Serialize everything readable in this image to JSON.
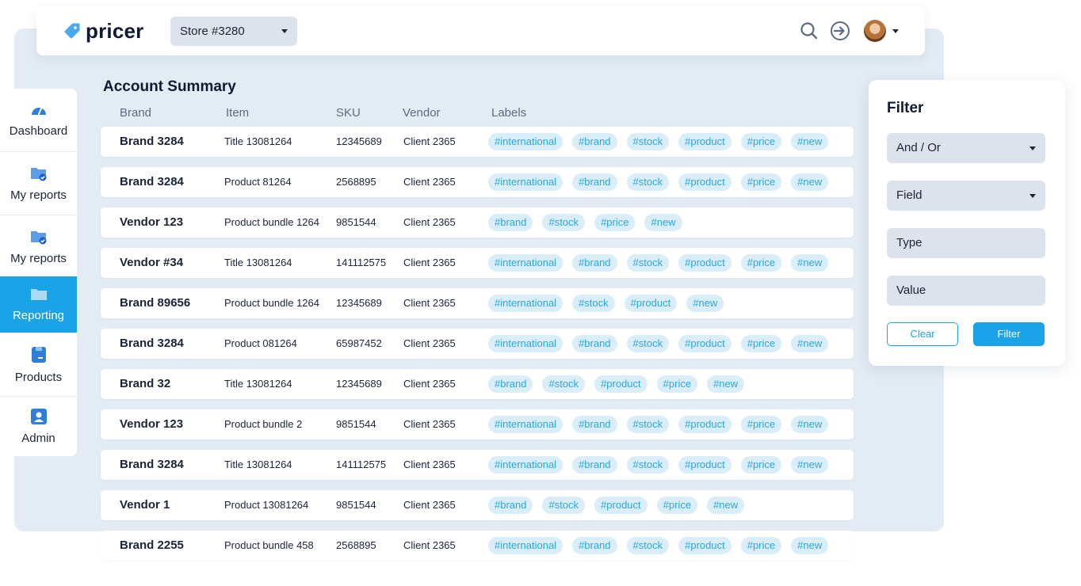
{
  "brand": {
    "logo_text": "pricer",
    "accent": "#1aa3e6",
    "tag_bg": "#d9eef9",
    "tag_text": "#2aa7e0"
  },
  "header": {
    "store_select": "Store #3280",
    "icons": [
      "search-icon",
      "sign-in-icon",
      "avatar",
      "chevron-down-icon"
    ]
  },
  "sidebar": {
    "items": [
      {
        "label": "Dashboard",
        "icon": "dashboard-gauge-icon"
      },
      {
        "label": "My reports",
        "icon": "folder-check-icon"
      },
      {
        "label": "My reports",
        "icon": "folder-check-icon"
      },
      {
        "label": "Reporting",
        "icon": "folder-icon",
        "active": true
      },
      {
        "label": "Products",
        "icon": "product-box-icon"
      },
      {
        "label": "Admin",
        "icon": "user-icon"
      }
    ]
  },
  "table": {
    "title": "Account Summary",
    "columns": [
      "Brand",
      "Item",
      "SKU",
      "Vendor",
      "Labels"
    ],
    "rows": [
      {
        "brand": "Brand 3284",
        "item": "Title 13081264",
        "sku": "12345689",
        "vendor": "Client 2365",
        "labels": [
          "#international",
          "#brand",
          "#stock",
          "#product",
          "#price",
          "#new"
        ]
      },
      {
        "brand": "Brand 3284",
        "item": "Product 81264",
        "sku": "2568895",
        "vendor": "Client 2365",
        "labels": [
          "#international",
          "#brand",
          "#stock",
          "#product",
          "#price",
          "#new"
        ]
      },
      {
        "brand": "Vendor 123",
        "item": "Product bundle 1264",
        "sku": "9851544",
        "vendor": "Client 2365",
        "labels": [
          "#brand",
          "#stock",
          "#price",
          "#new"
        ]
      },
      {
        "brand": "Vendor #34",
        "item": "Title 13081264",
        "sku": "141112575",
        "vendor": "Client 2365",
        "labels": [
          "#international",
          "#brand",
          "#stock",
          "#product",
          "#price",
          "#new"
        ]
      },
      {
        "brand": "Brand 89656",
        "item": "Product bundle 1264",
        "sku": "12345689",
        "vendor": "Client 2365",
        "labels": [
          "#international",
          "#stock",
          "#product",
          "#new"
        ]
      },
      {
        "brand": "Brand 3284",
        "item": "Product  081264",
        "sku": "65987452",
        "vendor": "Client 2365",
        "labels": [
          "#international",
          "#brand",
          "#stock",
          "#product",
          "#price",
          "#new"
        ]
      },
      {
        "brand": "Brand 32",
        "item": "Title 13081264",
        "sku": "12345689",
        "vendor": "Client 2365",
        "labels": [
          "#brand",
          "#stock",
          "#product",
          "#price",
          "#new"
        ]
      },
      {
        "brand": "Vendor 123",
        "item": "Product bundle 2",
        "sku": "9851544",
        "vendor": "Client 2365",
        "labels": [
          "#international",
          "#brand",
          "#stock",
          "#product",
          "#price",
          "#new"
        ]
      },
      {
        "brand": "Brand 3284",
        "item": "Title 13081264",
        "sku": "141112575",
        "vendor": "Client 2365",
        "labels": [
          "#international",
          "#brand",
          "#stock",
          "#product",
          "#price",
          "#new"
        ]
      },
      {
        "brand": "Vendor 1",
        "item": "Product  13081264",
        "sku": "9851544",
        "vendor": "Client 2365",
        "labels": [
          "#brand",
          "#stock",
          "#product",
          "#price",
          "#new"
        ]
      },
      {
        "brand": "Brand 2255",
        "item": "Product bundle 458",
        "sku": "2568895",
        "vendor": "Client 2365",
        "labels": [
          "#international",
          "#brand",
          "#stock",
          "#product",
          "#price",
          "#new"
        ]
      }
    ]
  },
  "filter": {
    "title": "Filter",
    "and_or": "And / Or",
    "field": "Field",
    "type_placeholder": "Type",
    "value_placeholder": "Value",
    "clear_label": "Clear",
    "filter_label": "Filter"
  }
}
